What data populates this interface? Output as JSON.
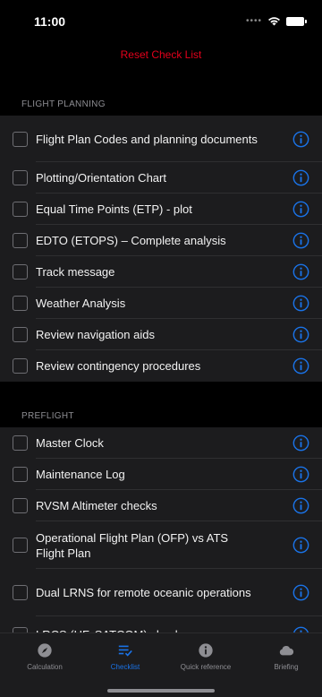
{
  "status": {
    "time": "11:00"
  },
  "header": {
    "reset_label": "Reset Check List"
  },
  "sections": [
    {
      "title": "FLIGHT PLANNING",
      "items": [
        {
          "label": "Flight Plan Codes and planning documents"
        },
        {
          "label": "Plotting/Orientation Chart"
        },
        {
          "label": "Equal Time Points (ETP) - plot"
        },
        {
          "label": "EDTO (ETOPS) – Complete analysis"
        },
        {
          "label": "Track message"
        },
        {
          "label": "Weather Analysis"
        },
        {
          "label": "Review navigation aids"
        },
        {
          "label": "Review contingency procedures"
        }
      ]
    },
    {
      "title": "PREFLIGHT",
      "items": [
        {
          "label": "Master Clock"
        },
        {
          "label": "Maintenance Log"
        },
        {
          "label": "RVSM Altimeter checks"
        },
        {
          "label": "Operational Flight Plan (OFP) vs ATS Flight Plan"
        },
        {
          "label": "Dual LRNS for remote oceanic operations"
        },
        {
          "label": "LRCS (HF, SATCOM) check"
        }
      ]
    }
  ],
  "tabs": [
    {
      "label": "Calculation",
      "icon": "compass-icon"
    },
    {
      "label": "Checklist",
      "icon": "checklist-icon"
    },
    {
      "label": "Quick reference",
      "icon": "info-icon"
    },
    {
      "label": "Briefing",
      "icon": "cloud-icon"
    }
  ],
  "colors": {
    "accent": "#1a73e8",
    "reset": "#e3001b",
    "row_bg": "#1c1c1e",
    "background": "#000000"
  }
}
